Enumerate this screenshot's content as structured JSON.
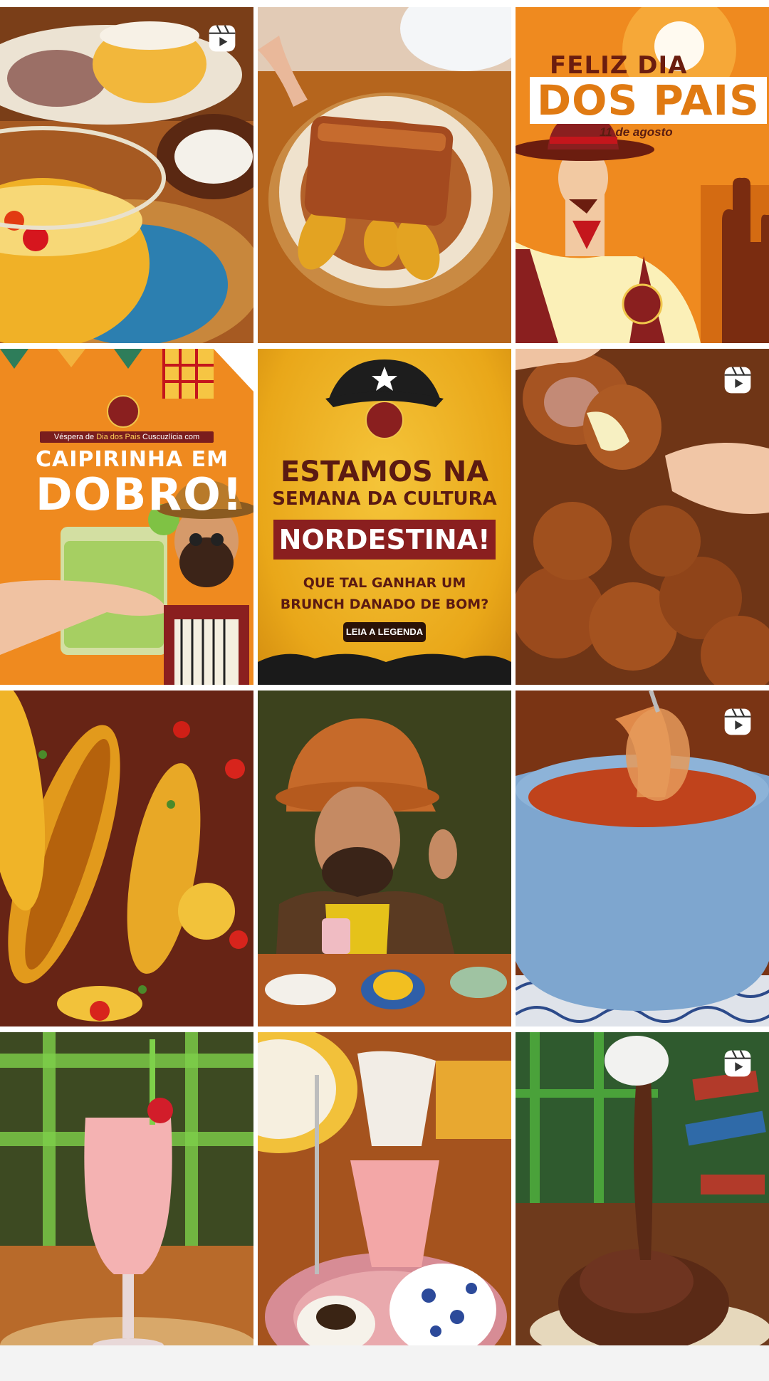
{
  "grid": {
    "tiles": [
      {
        "id": "moqueca-cuscuz",
        "is_reel": true
      },
      {
        "id": "carne-banana",
        "is_reel": false
      },
      {
        "id": "dia-dos-pais",
        "is_reel": false,
        "title_line1": "FELIZ DIA",
        "title_line2": "DOS PAIS",
        "date": "11 de agosto"
      },
      {
        "id": "caipirinha",
        "is_reel": false,
        "pre_text_before": "Véspera de ",
        "pre_text_highlight": "Dia dos Pais",
        "pre_text_after": " Cuscuzlícia com",
        "line1": "CAIPIRINHA EM",
        "line2": "DOBRO!"
      },
      {
        "id": "semana-cultura",
        "is_reel": false,
        "line1": "ESTAMOS NA",
        "line2": "SEMANA DA CULTURA",
        "band": "NORDESTINA!",
        "question1": "QUE TAL GANHAR UM",
        "question2": "BRUNCH DANADO DE BOM?",
        "button": "LEIA A LEGENDA"
      },
      {
        "id": "bolinho-queijo",
        "is_reel": true
      },
      {
        "id": "banana-frita",
        "is_reel": false
      },
      {
        "id": "homem-chapeu",
        "is_reel": false
      },
      {
        "id": "sopa",
        "is_reel": true
      },
      {
        "id": "milkshake-morango",
        "is_reel": false
      },
      {
        "id": "cafe-da-manha",
        "is_reel": false
      },
      {
        "id": "bolo-chocolate",
        "is_reel": true
      }
    ]
  },
  "colors": {
    "accent_orange": "#ef8a1f",
    "brand_red": "#8a1f1f",
    "yellow": "#f2b92a"
  }
}
